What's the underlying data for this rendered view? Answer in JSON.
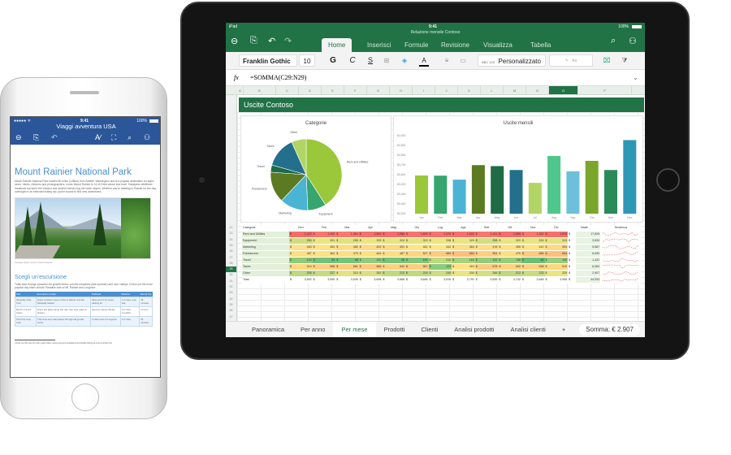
{
  "excel": {
    "status": {
      "device": "iPad",
      "time": "9:41",
      "battery": "100%"
    },
    "doc_title": "Relazione mensile Contoso",
    "tabs": [
      {
        "label": "Home",
        "active": true
      },
      {
        "label": "Inserisci"
      },
      {
        "label": "Formule"
      },
      {
        "label": "Revisione"
      },
      {
        "label": "Visualizza"
      },
      {
        "label": "Tabella"
      }
    ],
    "ribbon": {
      "font": "Franklin Gothic B",
      "size": "10",
      "bold": "G",
      "italic": "C",
      "underline": "S",
      "format_icon": "ABC 123",
      "number_format": "Personalizzato",
      "style_label": "Aa"
    },
    "formula": {
      "fx": "fx",
      "value": "=SOMMA(C29:N29)"
    },
    "columns": [
      "A",
      "B",
      "C",
      "D",
      "E",
      "F",
      "G",
      "H",
      "I",
      "J",
      "K",
      "L",
      "M",
      "N",
      "O",
      "P"
    ],
    "selected_column": "O",
    "banner": "Uscite Contoso",
    "row_numbers": [
      "22",
      "23",
      "24",
      "25",
      "26",
      "27",
      "28",
      "29",
      "30",
      "31",
      "32",
      "33",
      "34",
      "35",
      "36",
      "37",
      "38",
      "39"
    ],
    "selected_row": "29",
    "table": {
      "headers": [
        "Categorie",
        "Gen",
        "Feb",
        "Mar",
        "Apr",
        "Mag",
        "Giu",
        "Lug",
        "Ago",
        "Sett",
        "Ott",
        "Nov",
        "Dic",
        "Totale",
        "Tendenza"
      ],
      "currency": "$",
      "rows": [
        {
          "name": "Rent and Utilities",
          "values": [
            1570,
            1400,
            1364,
            1500,
            1580,
            1460,
            1476,
            1503,
            1411,
            1590,
            1352,
            1515
          ],
          "total": "17,829"
        },
        {
          "name": "Equipment",
          "values": [
            250,
            331,
            299,
            333,
            324,
            313,
            338,
            329,
            258,
            322,
            324,
            313
          ],
          "total": "3,630"
        },
        {
          "name": "Marketing",
          "values": [
            463,
            452,
            482,
            492,
            491,
            442,
            442,
            464,
            478,
            455,
            442,
            494
          ],
          "total": "5,587"
        },
        {
          "name": "Freelancers",
          "values": [
            467,
            463,
            475,
            464,
            487,
            527,
            585,
            654,
            554,
            475,
            585,
            654
          ],
          "total": "6,090"
        },
        {
          "name": "Travel",
          "values": [
            123,
            93,
            98,
            131,
            98,
            109,
            212,
            163,
            132,
            138,
            84,
            140
          ],
          "total": "1,422"
        },
        {
          "name": "Taxes",
          "values": [
            514,
            558,
            561,
            586,
            542,
            567,
            123,
            453,
            578,
            542,
            538,
            510
          ],
          "total": "6,063"
        },
        {
          "name": "Other",
          "values": [
            205,
            227,
            310,
            282,
            213,
            214,
            240,
            330,
            266,
            213,
            233,
            329
          ],
          "total": "2,907"
        }
      ],
      "total_row": {
        "name": "Total",
        "values": [
          3592,
          3590,
          3549,
          3698,
          3688,
          3648,
          3516,
          3792,
          3635,
          3742,
          3648,
          3955
        ],
        "total": "44,033"
      }
    },
    "sheets": [
      {
        "label": "Panoramica"
      },
      {
        "label": "Per anno"
      },
      {
        "label": "Per mese",
        "active": true
      },
      {
        "label": "Prodotti"
      },
      {
        "label": "Clienti"
      },
      {
        "label": "Analisi prodotti"
      },
      {
        "label": "Analisi clienti"
      }
    ],
    "add_sheet": "+",
    "sum": "Somma:  € 2.907",
    "accent": "#217346"
  },
  "chart_data": [
    {
      "type": "pie",
      "title": "Categorie",
      "categories": [
        "Rent and Utilities",
        "Equipment",
        "Marketing",
        "Freelancers",
        "Travel",
        "Taxes",
        "Other"
      ],
      "values": [
        17829,
        3630,
        5587,
        6090,
        1422,
        6063,
        2907
      ],
      "colors": [
        "#9bc83a",
        "#36a56e",
        "#4bb3d4",
        "#5b7a22",
        "#1e6b46",
        "#236f8c",
        "#b0d565"
      ]
    },
    {
      "type": "bar",
      "title": "Uscite mensili",
      "categories": [
        "Jan",
        "Feb",
        "Mar",
        "Apr",
        "May",
        "Jun",
        "Jul",
        "Aug",
        "Sep",
        "Oct",
        "Nov",
        "Dec"
      ],
      "values": [
        3592,
        3590,
        3549,
        3698,
        3688,
        3648,
        3516,
        3792,
        3635,
        3742,
        3648,
        3955
      ],
      "ylim": [
        3200,
        4000
      ],
      "yticks": [
        "$3,200",
        "$3,300",
        "$3,400",
        "$3,500",
        "$3,600",
        "$3,700",
        "$3,800",
        "$3,900",
        "$4,000"
      ],
      "colors": [
        "#9bc83a",
        "#36a56e",
        "#4bb3d4",
        "#5b7a22",
        "#1e6b46",
        "#236f8c",
        "#b0d565",
        "#50c78a",
        "#6cc0da",
        "#7aa62c",
        "#2a8a5a",
        "#2e97b5"
      ],
      "grid": false
    }
  ],
  "word": {
    "status": {
      "signal": "●●●●● ᯤ",
      "time": "9:41",
      "battery": "100%"
    },
    "doc_title": "Viaggi avventura USA",
    "heading": "Mount Rainier National Park",
    "intro": "Mount Rainier National Park located 60 miles (128km) from Seattle, Washington and is a popular destination for sight-seers, hikers, climbers and photographers. Iconic Mount Rainier is 14,410 feet above sea level. Subalpine wildflower meadows surround the volcano and ancient forests ring the lower slopes. Whether you're heading to Rainier for the day, overnight or an extended hiking trip, you're bound to find new adventures.",
    "caption": "Paradise Visitor Center at Mount Rainier",
    "subheading": "Scegli un'escursione",
    "para2": "Trails lead through peaceful old growth forest, colorful meadows (late summer) and river valleys. Check out the most popular day hikes at both Paradise side of Mt. Rainier and Longmire.",
    "trails": {
      "headers": [
        "Trail",
        "Description of Hike",
        "Trailhead",
        "Distance",
        "Round Trip"
      ],
      "rows": [
        [
          "Nisqually Vista Trail",
          "Enjoy excellent views of Mount Rainier and the Nisqually Glacier",
          "West end of the lower parking lot",
          "1.2 miles, loop trail",
          "45 minutes"
        ],
        [
          "Bench & Snow Lakes",
          "Enjoy two lakes along this trail. See bear grass & flowers.",
          "Stevens Canyon Road",
          "2.5 miles roundtrip",
          "2 hours"
        ],
        [
          "Twin Firs Loop Trail",
          "This short loop trail passes through old growth forest",
          "2 miles west of Longmire",
          "0.4 miles",
          "20 minutes"
        ]
      ]
    },
    "footnote": "Check out this site for other great hikes: www.nps.gov/mora/planyourvisit/day-hiking-at-mount-rainier.htm",
    "accent": "#2b579a"
  }
}
